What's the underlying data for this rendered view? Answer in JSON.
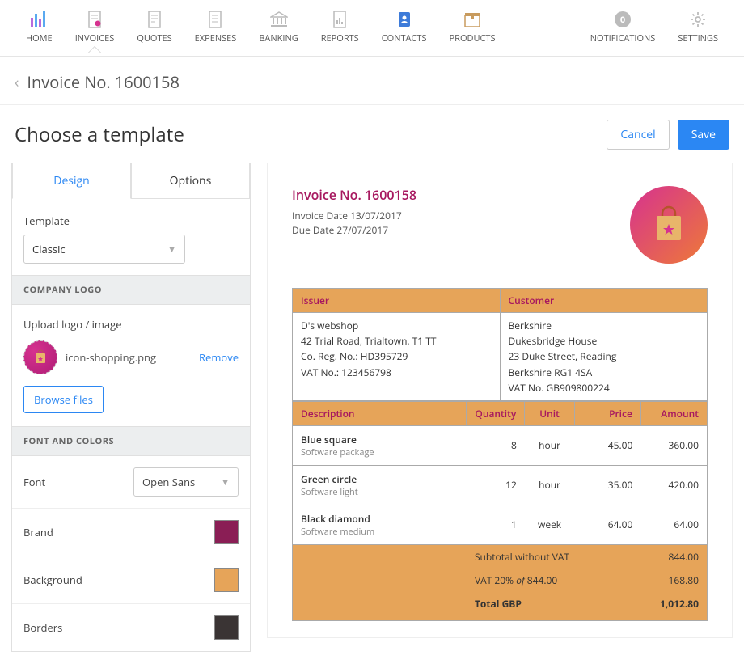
{
  "nav": {
    "items": [
      {
        "label": "HOME"
      },
      {
        "label": "INVOICES"
      },
      {
        "label": "QUOTES"
      },
      {
        "label": "EXPENSES"
      },
      {
        "label": "BANKING"
      },
      {
        "label": "REPORTS"
      },
      {
        "label": "CONTACTS"
      },
      {
        "label": "PRODUCTS"
      }
    ],
    "notifications_label": "NOTIFICATIONS",
    "notifications_count": "0",
    "settings_label": "SETTINGS"
  },
  "crumb": {
    "title": "Invoice No. 1600158"
  },
  "header": {
    "title": "Choose a template",
    "cancel": "Cancel",
    "save": "Save"
  },
  "sidebar": {
    "tabs": {
      "design": "Design",
      "options": "Options"
    },
    "template_label": "Template",
    "template_value": "Classic",
    "logo_section": "COMPANY LOGO",
    "upload_label": "Upload logo / image",
    "logo_filename": "icon-shopping.png",
    "remove": "Remove",
    "browse": "Browse files",
    "fonts_section": "FONT AND COLORS",
    "font_label": "Font",
    "font_value": "Open Sans",
    "brand_label": "Brand",
    "background_label": "Background",
    "borders_label": "Borders",
    "colors": {
      "brand": "#8a1e55",
      "background": "#e6a459",
      "borders": "#3a3434"
    }
  },
  "invoice": {
    "title": "Invoice No. 1600158",
    "date_label": "Invoice Date 13/07/2017",
    "due_label": "Due Date 27/07/2017",
    "issuer_hdr": "Issuer",
    "customer_hdr": "Customer",
    "issuer_lines": [
      "D's webshop",
      "42 Trial Road, Trialtown, T1 TT",
      "Co. Reg. No.: HD395729",
      "VAT No.: 123456798"
    ],
    "customer_lines": [
      "Berkshire",
      "Dukesbridge House",
      "23 Duke Street, Reading",
      "Berkshire RG1 4SA",
      "VAT No. GB909800224"
    ],
    "cols": {
      "desc": "Description",
      "qty": "Quantity",
      "unit": "Unit",
      "price": "Price",
      "amount": "Amount"
    },
    "lines": [
      {
        "name": "Blue square",
        "sub": "Software package",
        "qty": "8",
        "unit": "hour",
        "price": "45.00",
        "amount": "360.00"
      },
      {
        "name": "Green circle",
        "sub": "Software light",
        "qty": "12",
        "unit": "hour",
        "price": "35.00",
        "amount": "420.00"
      },
      {
        "name": "Black diamond",
        "sub": "Software medium",
        "qty": "1",
        "unit": "week",
        "price": "64.00",
        "amount": "64.00"
      }
    ],
    "totals": {
      "subtotal_label": "Subtotal without VAT",
      "subtotal": "844.00",
      "vat_label_a": "VAT 20% ",
      "vat_label_of": "of",
      "vat_label_b": " 844.00",
      "vat": "168.80",
      "total_label": "Total GBP",
      "total": "1,012.80"
    }
  }
}
